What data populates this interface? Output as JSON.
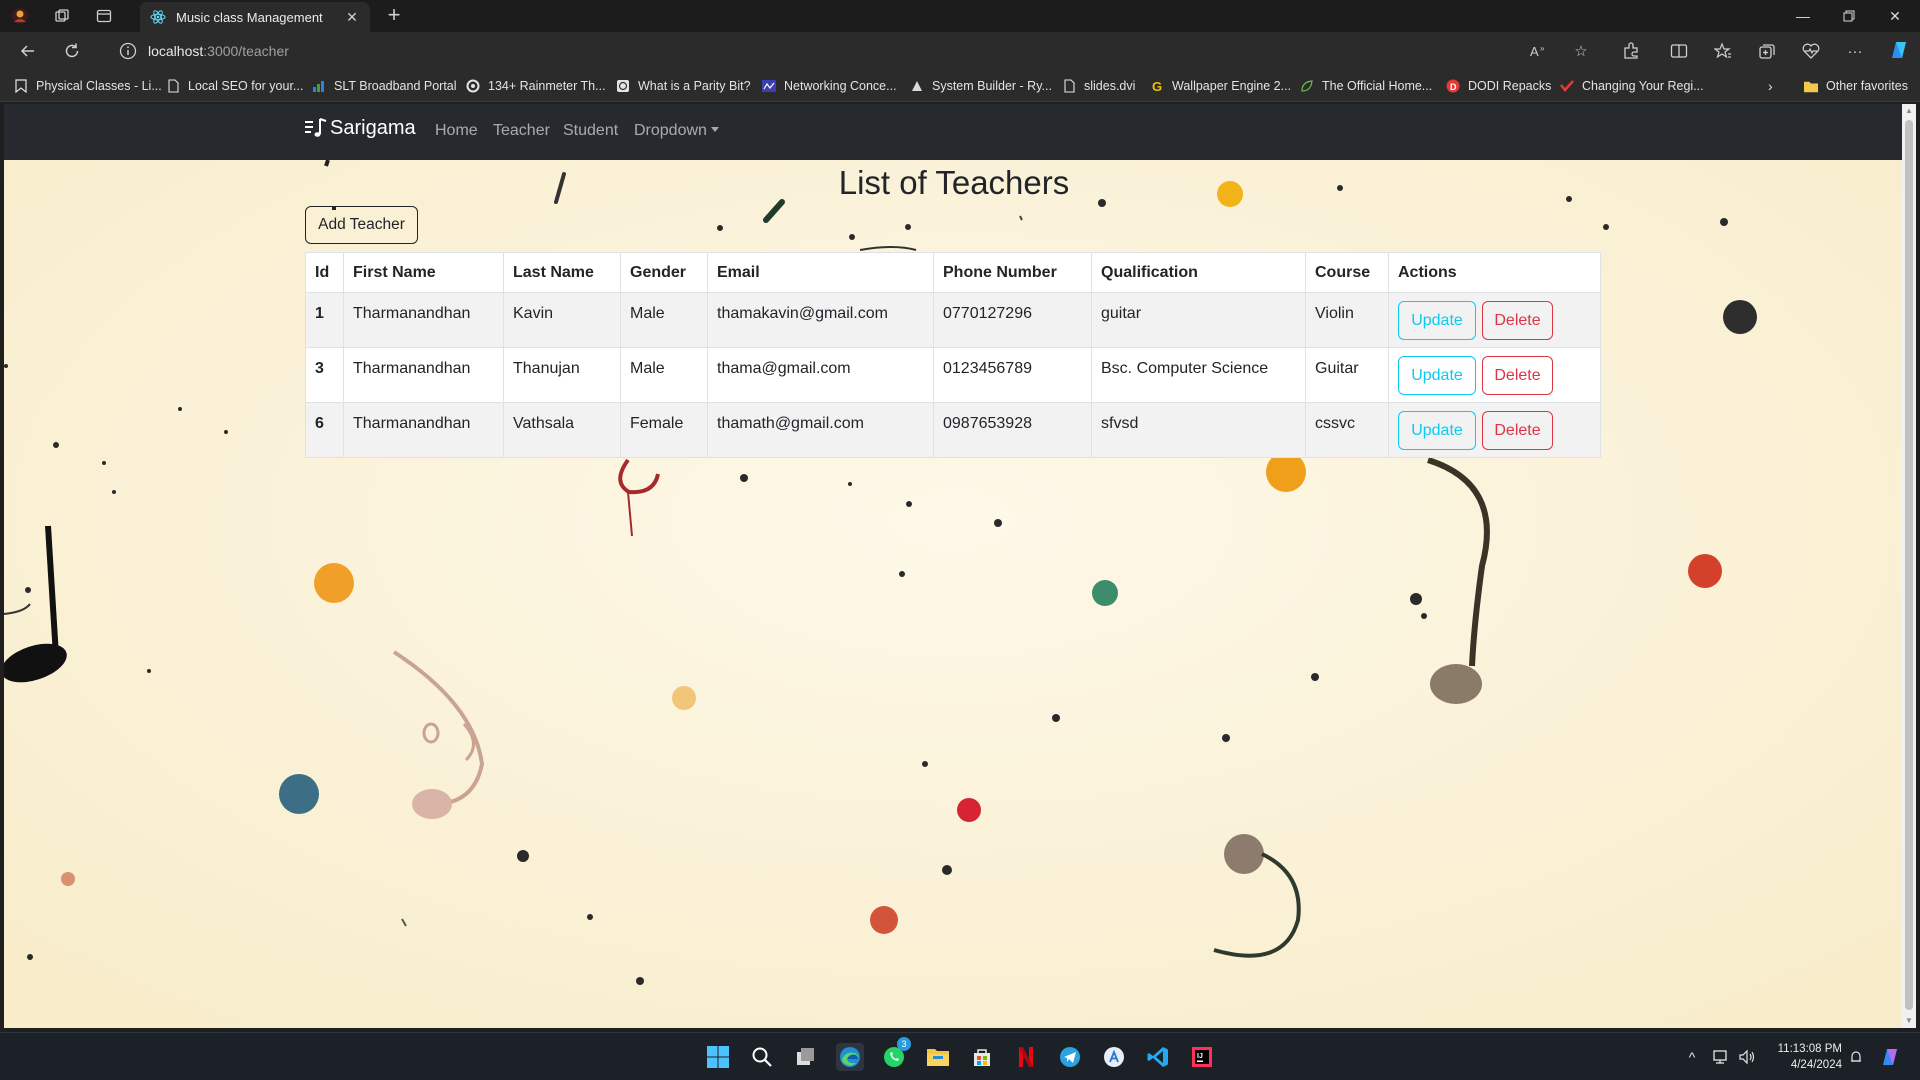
{
  "browser": {
    "tab_title": "Music class Management",
    "url_host": "localhost",
    "url_rest": ":3000/teacher",
    "favorites": [
      "Physical Classes - Li...",
      "Local SEO for your...",
      "SLT Broadband Portal",
      "134+ Rainmeter Th...",
      "What is a Parity Bit?",
      "Networking Conce...",
      "System Builder - Ry...",
      "slides.dvi",
      "Wallpaper Engine 2...",
      "The Official Home...",
      "DODI Repacks",
      "Changing Your Regi..."
    ],
    "other_favorites": "Other favorites"
  },
  "app": {
    "brand": "Sarigama",
    "nav": {
      "home": "Home",
      "teacher": "Teacher",
      "student": "Student",
      "dropdown": "Dropdown"
    }
  },
  "main": {
    "title": "List of Teachers",
    "add_button": "Add Teacher",
    "columns": [
      "Id",
      "First Name",
      "Last Name",
      "Gender",
      "Email",
      "Phone Number",
      "Qualification",
      "Course",
      "Actions"
    ],
    "rows": [
      {
        "id": "1",
        "first_name": "Tharmanandhan",
        "last_name": "Kavin",
        "gender": "Male",
        "email": "thamakavin@gmail.com",
        "phone": "0770127296",
        "qualification": "guitar",
        "course": "Violin"
      },
      {
        "id": "3",
        "first_name": "Tharmanandhan",
        "last_name": "Thanujan",
        "gender": "Male",
        "email": "thama@gmail.com",
        "phone": "0123456789",
        "qualification": "Bsc. Computer Science",
        "course": "Guitar"
      },
      {
        "id": "6",
        "first_name": "Tharmanandhan",
        "last_name": "Vathsala",
        "gender": "Female",
        "email": "thamath@gmail.com",
        "phone": "0987653928",
        "qualification": "sfvsd",
        "course": "cssvc"
      }
    ],
    "update_label": "Update",
    "delete_label": "Delete"
  },
  "taskbar": {
    "time": "11:13:08 PM",
    "date": "4/24/2024",
    "whatsapp_badge": "3"
  },
  "colors": {
    "update_outline": "#0dcaf0",
    "delete_outline": "#dc3545",
    "navbar": "#262a2e",
    "page_background": "#fbf3dd"
  }
}
